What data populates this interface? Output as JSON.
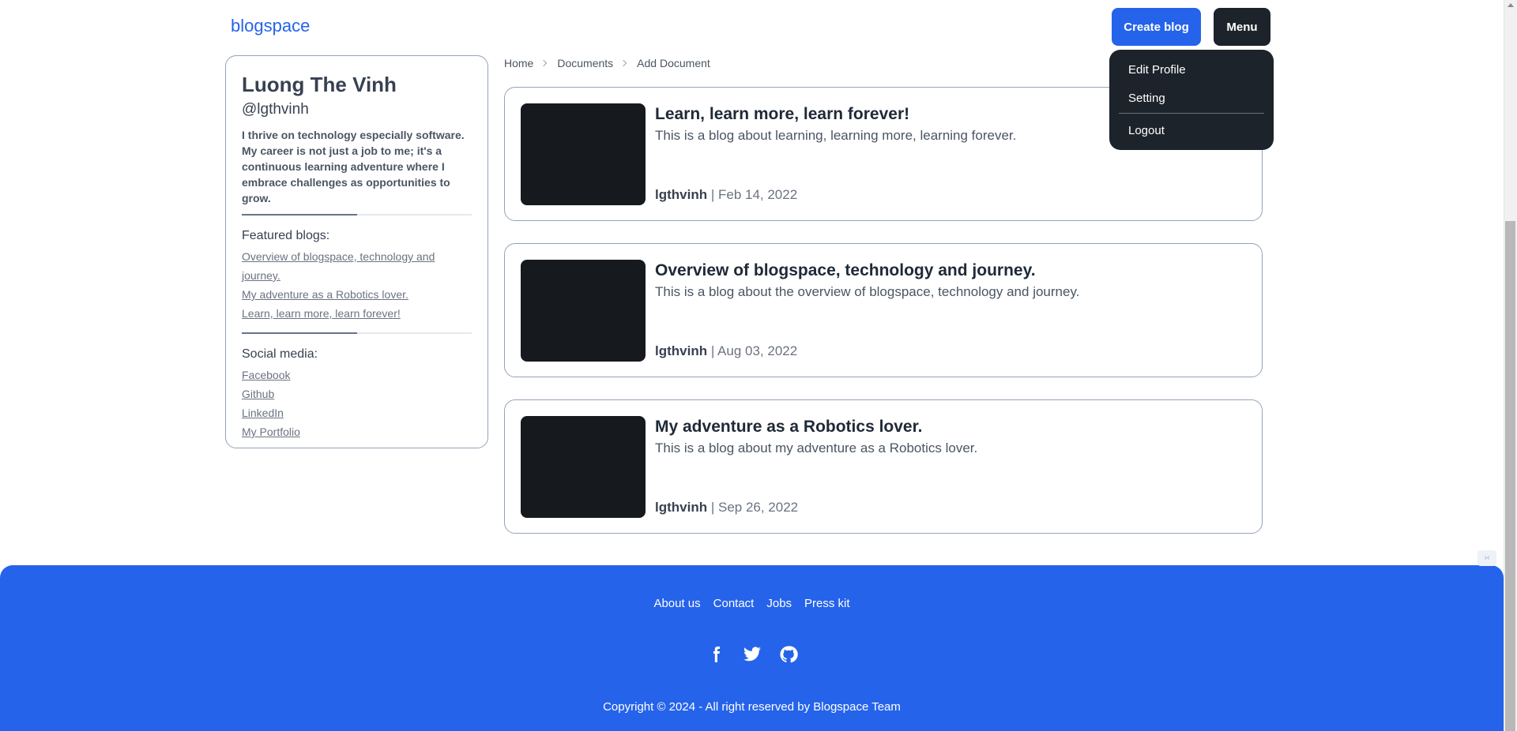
{
  "header": {
    "logo": "blogspace",
    "create_label": "Create blog",
    "menu_label": "Menu"
  },
  "dropdown": {
    "items": [
      "Edit Profile",
      "Setting",
      "Logout"
    ]
  },
  "profile": {
    "name": "Luong The Vinh",
    "handle": "@lgthvinh",
    "bio": "I thrive on technology especially software. My career is not just a job to me; it's a continuous learning adventure where I embrace challenges as opportunities to grow.",
    "featured_title": "Featured blogs:",
    "featured": [
      "Overview of blogspace, technology and journey.",
      "My adventure as a Robotics lover.",
      "Learn, learn more, learn forever!"
    ],
    "social_title": "Social media:",
    "social": [
      "Facebook",
      "Github",
      "LinkedIn",
      "My Portfolio"
    ]
  },
  "breadcrumb": [
    "Home",
    "Documents",
    "Add Document"
  ],
  "posts": [
    {
      "title": "Learn, learn more, learn forever!",
      "description": "This is a blog about learning, learning more, learning forever.",
      "author": "lgthvinh",
      "date": "Feb 14, 2022"
    },
    {
      "title": "Overview of blogspace, technology and journey.",
      "description": "This is a blog about the overview of blogspace, technology and journey.",
      "author": "lgthvinh",
      "date": "Aug 03, 2022"
    },
    {
      "title": "My adventure as a Robotics lover.",
      "description": "This is a blog about my adventure as a Robotics lover.",
      "author": "lgthvinh",
      "date": "Sep 26, 2022"
    }
  ],
  "footer": {
    "links": [
      "About us",
      "Contact",
      "Jobs",
      "Press kit"
    ],
    "icons": [
      "facebook-icon",
      "twitter-icon",
      "github-icon"
    ],
    "copyright": "Copyright © 2024 - All right reserved by Blogspace Team"
  },
  "colors": {
    "primary": "#2563eb",
    "dark": "#1d232a",
    "border": "#94a3b8"
  }
}
